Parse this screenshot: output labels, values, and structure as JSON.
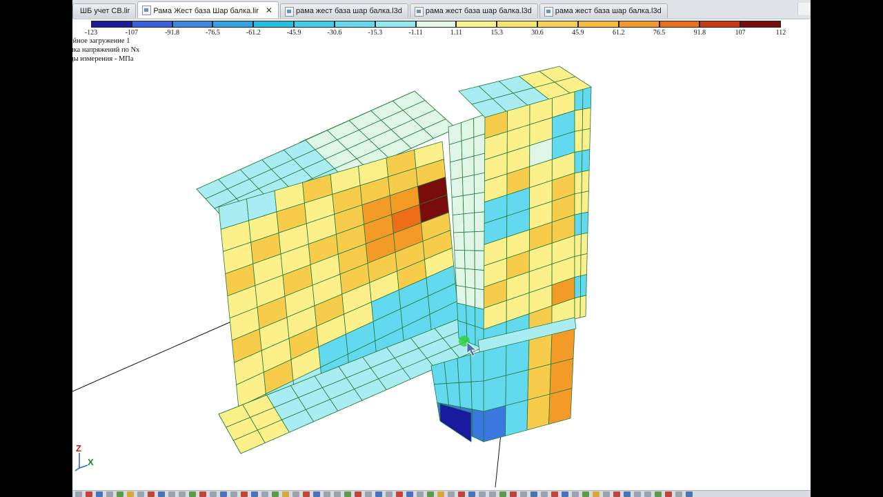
{
  "tabs": [
    {
      "label": "ШБ учет СВ.lir",
      "active": false
    },
    {
      "label": "Рама Жест база Шар балка.lir",
      "active": true,
      "close": "✕"
    },
    {
      "label": "рама жест база шар балка.l3d",
      "active": false
    },
    {
      "label": "рама жест база шар балка.l3d",
      "active": false
    },
    {
      "label": "рама жест база шар балка.l3d",
      "active": false
    }
  ],
  "legend": {
    "ticks": [
      "-123",
      "-107",
      "-91.8",
      "-76.5",
      "-61.2",
      "-45.9",
      "-30.6",
      "-15.3",
      "-1.11",
      "1.11",
      "15.3",
      "30.6",
      "45.9",
      "61.2",
      "76.5",
      "91.8",
      "107",
      "112"
    ],
    "colors": [
      "#1a1a9e",
      "#3a5fe0",
      "#3f86e6",
      "#2fa2e8",
      "#22bfe6",
      "#40cdea",
      "#62d9ee",
      "#8fe7f2",
      "#e3f7ea",
      "#fbf48c",
      "#f9e56a",
      "#f6d24e",
      "#f7bd3a",
      "#f39a27",
      "#ee6d16",
      "#c63a14",
      "#7a0c0c"
    ]
  },
  "info": {
    "line1": "ейное загружение 1",
    "line2": "ика напряжений по Nx",
    "line3": "цы измерения - МПа"
  },
  "axes": {
    "z": "Z",
    "x": "X"
  },
  "palette": {
    "grid": "#1f7a3a",
    "cyan": "#62d9ee",
    "light_cyan": "#a9ecf2",
    "pale": "#dff6e6",
    "yellow": "#f9e56a",
    "light_yellow": "#fbf08a",
    "gold": "#f6cc4a",
    "orange": "#f39a27",
    "dark_orange": "#ee6d16",
    "dark_red": "#7a0c0c",
    "blue": "#3a78e0",
    "dark_blue": "#1a1a9e"
  }
}
